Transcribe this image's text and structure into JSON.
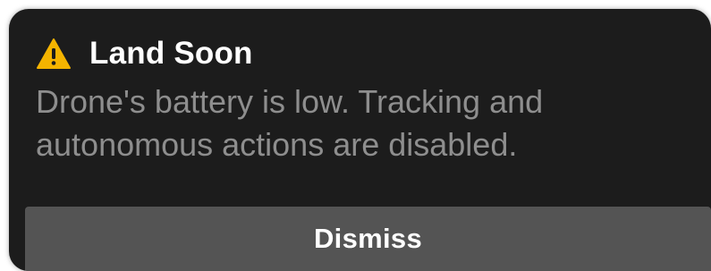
{
  "alert": {
    "icon": "warning-triangle-icon",
    "icon_color": "#f5b400",
    "title": "Land Soon",
    "message": "Drone's battery is low. Tracking and autonomous actions are disabled.",
    "dismiss_label": "Dismiss"
  },
  "colors": {
    "background": "#1c1c1c",
    "title": "#ffffff",
    "message": "#8e8e8e",
    "button": "#545454"
  }
}
